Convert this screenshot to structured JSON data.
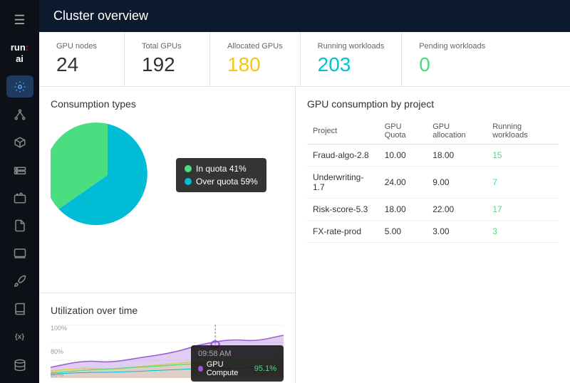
{
  "header": {
    "title": "Cluster overview",
    "logo_line1": "run:",
    "logo_line2": "ai"
  },
  "sidebar": {
    "items": [
      {
        "id": "hamburger",
        "icon": "☰",
        "label": "menu"
      },
      {
        "id": "dashboard",
        "icon": "📡",
        "label": "dashboard",
        "active": true
      },
      {
        "id": "nodes",
        "icon": "⬡",
        "label": "nodes"
      },
      {
        "id": "packages",
        "icon": "📦",
        "label": "packages"
      },
      {
        "id": "storage",
        "icon": "🗄",
        "label": "storage"
      },
      {
        "id": "jobs",
        "icon": "💼",
        "label": "jobs"
      },
      {
        "id": "files",
        "icon": "📄",
        "label": "files"
      },
      {
        "id": "laptop",
        "icon": "💻",
        "label": "laptop"
      },
      {
        "id": "rocket",
        "icon": "🚀",
        "label": "rocket"
      },
      {
        "id": "book",
        "icon": "📖",
        "label": "book"
      },
      {
        "id": "api",
        "icon": "{x}",
        "label": "api"
      },
      {
        "id": "db",
        "icon": "🗃",
        "label": "database"
      }
    ]
  },
  "stats": [
    {
      "label": "GPU nodes",
      "value": "24",
      "color": "normal"
    },
    {
      "label": "Total GPUs",
      "value": "192",
      "color": "normal"
    },
    {
      "label": "Allocated GPUs",
      "value": "180",
      "color": "yellow"
    },
    {
      "label": "Running workloads",
      "value": "203",
      "color": "teal"
    },
    {
      "label": "Pending workloads",
      "value": "0",
      "color": "green"
    }
  ],
  "consumption": {
    "title": "Consumption types",
    "tooltip": {
      "in_quota_label": "In quota 41%",
      "over_quota_label": "Over quota 59%"
    },
    "pie": {
      "in_quota_pct": 41,
      "over_quota_pct": 59,
      "color_in": "#4ade80",
      "color_over": "#00bcd4"
    }
  },
  "gpu_table": {
    "title": "GPU consumption by project",
    "columns": [
      "Project",
      "GPU Quota",
      "GPU allocation",
      "Running workloads"
    ],
    "rows": [
      {
        "project": "Fraud-algo-2.8",
        "quota": "10.00",
        "allocation": "18.00",
        "running": "15"
      },
      {
        "project": "Underwriting-1.7",
        "quota": "24.00",
        "allocation": "9.00",
        "running": "7"
      },
      {
        "project": "Risk-score-5.3",
        "quota": "18.00",
        "allocation": "22.00",
        "running": "17"
      },
      {
        "project": "FX-rate-prod",
        "quota": "5.00",
        "allocation": "3.00",
        "running": "3"
      }
    ]
  },
  "utilization": {
    "title": "Utilization over time",
    "y_labels": [
      "100%",
      "80%",
      "60%"
    ],
    "tooltip": {
      "time": "09:58 AM",
      "metric": "GPU Compute",
      "value": "95.1%"
    }
  }
}
